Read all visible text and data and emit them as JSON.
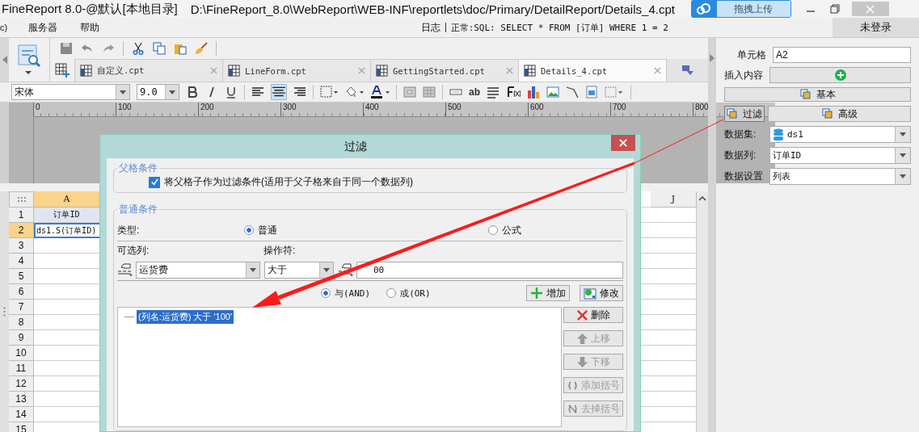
{
  "window": {
    "title": "FineReport 8.0-@默认[本地目录]",
    "path": "D:\\FineReport_8.0\\WebReport\\WEB-INF\\reportlets\\doc/Primary/DetailReport/Details_4.cpt",
    "upload_button": "拖拽上传"
  },
  "menu": [
    "c)",
    "服务器",
    "帮助"
  ],
  "log": {
    "label": "日志",
    "status": "正常:SQL: SELECT * FROM [订单] WHERE 1 = 2"
  },
  "login": "未登录",
  "tabs": [
    {
      "label": "自定义.cpt",
      "selected": false
    },
    {
      "label": "LineForm.cpt",
      "selected": false
    },
    {
      "label": "GettingStarted.cpt",
      "selected": false
    },
    {
      "label": "Details_4.cpt",
      "selected": true
    }
  ],
  "format_bar": {
    "font": "宋体",
    "size": "9.0",
    "text_tool": "ab"
  },
  "ruler": [
    "0",
    "100",
    "200",
    "300",
    "400",
    "500",
    "600",
    "700",
    "800"
  ],
  "grid": {
    "columns": [
      {
        "label": "A",
        "selected": true
      },
      {
        "label": "J",
        "selected": false
      }
    ],
    "rows": [
      {
        "header": "1",
        "cell": "订单ID",
        "selected": false
      },
      {
        "header": "2",
        "cell": "ds1.S(订单ID)",
        "selected": true
      },
      {
        "header": "3",
        "cell": "",
        "selected": false
      },
      {
        "header": "4",
        "cell": "",
        "selected": false
      },
      {
        "header": "5",
        "cell": "",
        "selected": false
      },
      {
        "header": "6",
        "cell": "",
        "selected": false
      },
      {
        "header": "7",
        "cell": "",
        "selected": false
      },
      {
        "header": "8",
        "cell": "",
        "selected": false
      },
      {
        "header": "9",
        "cell": "",
        "selected": false
      },
      {
        "header": "10",
        "cell": "",
        "selected": false
      },
      {
        "header": "11",
        "cell": "",
        "selected": false
      },
      {
        "header": "12",
        "cell": "",
        "selected": false
      },
      {
        "header": "13",
        "cell": "",
        "selected": false
      },
      {
        "header": "14",
        "cell": "",
        "selected": false
      },
      {
        "header": "15",
        "cell": "",
        "selected": false
      }
    ]
  },
  "dialog": {
    "title": "过滤",
    "parent_group": {
      "legend": "父格条件",
      "checkbox_label": "将父格子作为过滤条件(适用于父子格来自于同一个数据列)",
      "checked": true
    },
    "normal_group": {
      "legend": "普通条件",
      "type_label": "类型:",
      "types": [
        {
          "label": "普通",
          "selected": true
        },
        {
          "label": "公式",
          "selected": false
        }
      ],
      "column_label": "可选列:",
      "column_value": "运货费",
      "operator_label": "操作符:",
      "operator_value": "大于",
      "value": "00",
      "joins": [
        {
          "label": "与(AND)",
          "selected": true
        },
        {
          "label": "或(OR)",
          "selected": false
        }
      ],
      "add_button": "增加",
      "modify_button": "修改",
      "conditions": [
        {
          "text": "(列名:运货费) 大于 '100'",
          "selected": true
        }
      ],
      "side_buttons": [
        {
          "kind": "delete",
          "label": "删除",
          "disabled": false
        },
        {
          "kind": "up",
          "label": "上移",
          "disabled": true
        },
        {
          "kind": "down",
          "label": "下移",
          "disabled": true
        },
        {
          "kind": "add_paren",
          "label": "添加括号",
          "disabled": true
        },
        {
          "kind": "remove_paren",
          "label": "去掉括号",
          "disabled": true
        }
      ]
    }
  },
  "panel": {
    "cell_label": "单元格",
    "cell_value": "A2",
    "insert_label": "插入内容",
    "basic_button": "基本",
    "filter_button": {
      "label": "过滤",
      "selected": true
    },
    "advanced_button": "高级",
    "fields": [
      {
        "kind": "dataset",
        "label": "数据集:",
        "value": "ds1"
      },
      {
        "kind": "plain",
        "label": "数据列:",
        "value": "订单ID"
      },
      {
        "kind": "plain",
        "label": "数据设置",
        "value": "列表"
      }
    ]
  }
}
